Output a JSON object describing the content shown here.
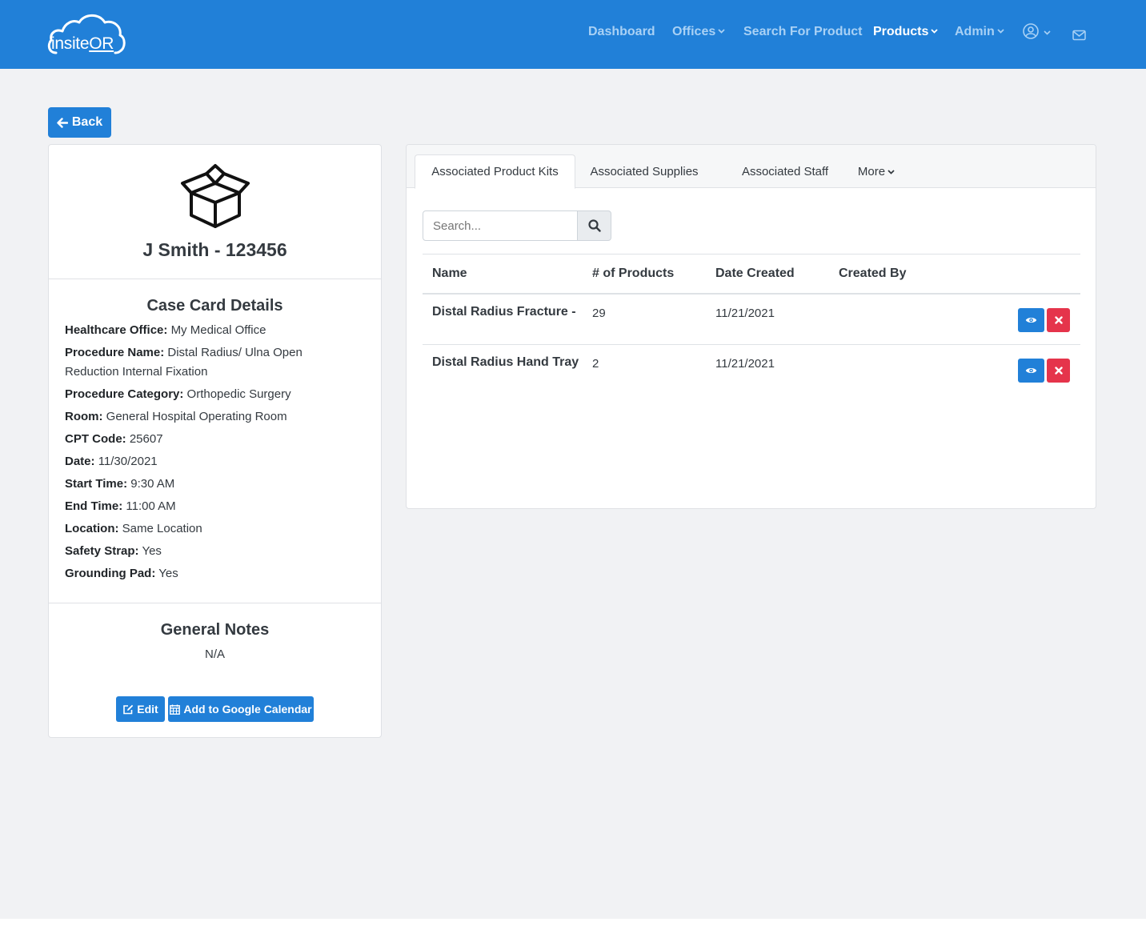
{
  "brand": {
    "logo_text_a": "insite",
    "logo_text_b": "OR"
  },
  "nav": {
    "items": [
      {
        "label": "Dashboard"
      },
      {
        "label": "Offices"
      },
      {
        "label": "Search For Product"
      },
      {
        "label": "Products"
      },
      {
        "label": "Admin"
      }
    ],
    "icons": [
      "user-circle-icon",
      "chevron-down-icon",
      "envelope-icon"
    ]
  },
  "back_button": {
    "label": "Back"
  },
  "case": {
    "title": "J Smith - 123456",
    "details_title": "Case Card Details",
    "details": [
      {
        "label": "Healthcare Office:",
        "value": "My Medical Office"
      },
      {
        "label": "Procedure Name:",
        "value": "Distal Radius/ Ulna Open Reduction Internal Fixation"
      },
      {
        "label": "Procedure Category:",
        "value": "Orthopedic Surgery"
      },
      {
        "label": "Room:",
        "value": "General Hospital Operating Room"
      },
      {
        "label": "CPT Code:",
        "value": "25607"
      },
      {
        "label": "Date:",
        "value": "11/30/2021"
      },
      {
        "label": "Start Time:",
        "value": "9:30 AM"
      },
      {
        "label": "End Time:",
        "value": "11:00 AM"
      },
      {
        "label": "Location:",
        "value": "Same Location"
      },
      {
        "label": "Safety Strap:",
        "value": "Yes"
      },
      {
        "label": "Grounding Pad:",
        "value": "Yes"
      }
    ],
    "notes_title": "General Notes",
    "notes_value": "N/A",
    "edit_label": "Edit",
    "calendar_label": "Add to Google Calendar"
  },
  "tabs": [
    {
      "label": "Associated Product Kits",
      "active": true
    },
    {
      "label": "Associated Supplies",
      "active": false
    },
    {
      "label": "Associated Staff",
      "active": false
    },
    {
      "label": "More",
      "active": false
    }
  ],
  "search": {
    "placeholder": "Search..."
  },
  "table": {
    "headers": [
      "Name",
      "# of Products",
      "Date Created",
      "Created By"
    ],
    "rows": [
      {
        "name": "Distal Radius Fracture -",
        "products": "29",
        "date": "11/21/2021",
        "created_by": ""
      },
      {
        "name": "Distal Radius Hand Tray",
        "products": "2",
        "date": "11/21/2021",
        "created_by": ""
      }
    ]
  },
  "colors": {
    "primary": "#2180d8",
    "danger": "#e5344b",
    "background": "#f1f2f4"
  }
}
